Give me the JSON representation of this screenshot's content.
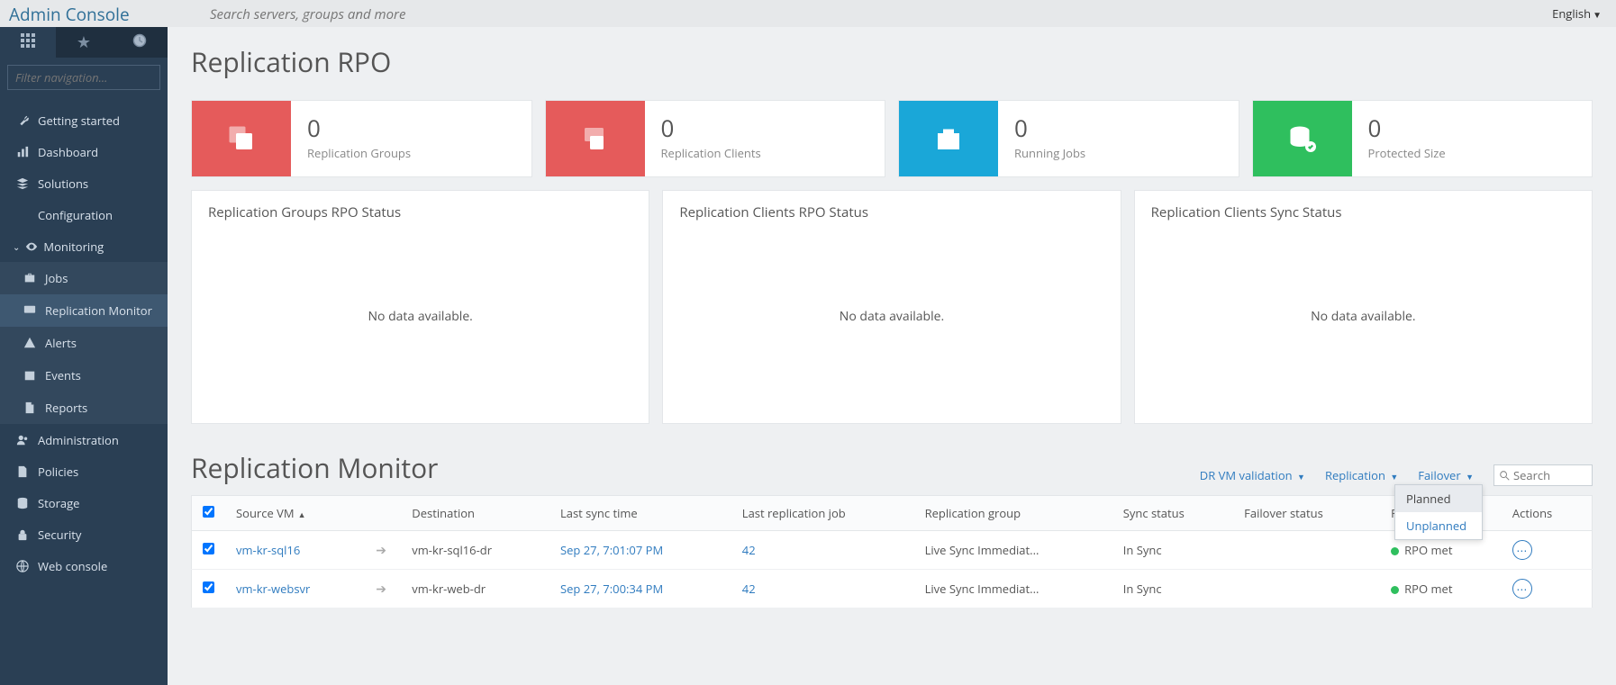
{
  "app_title": "Admin Console",
  "global_search_placeholder": "Search servers, groups and more",
  "language": "English",
  "nav_filter_placeholder": "Filter navigation...",
  "nav": {
    "getting_started": "Getting started",
    "dashboard": "Dashboard",
    "solutions": "Solutions",
    "configuration": "Configuration",
    "monitoring": "Monitoring",
    "jobs": "Jobs",
    "replication_monitor": "Replication Monitor",
    "alerts": "Alerts",
    "events": "Events",
    "reports": "Reports",
    "administration": "Administration",
    "policies": "Policies",
    "storage": "Storage",
    "security": "Security",
    "web_console": "Web console"
  },
  "page_title": "Replication RPO",
  "kpis": [
    {
      "value": "0",
      "label": "Replication Groups",
      "color": "red"
    },
    {
      "value": "0",
      "label": "Replication Clients",
      "color": "red"
    },
    {
      "value": "0",
      "label": "Running Jobs",
      "color": "blue"
    },
    {
      "value": "0",
      "label": "Protected Size",
      "color": "green"
    }
  ],
  "panels": [
    {
      "title": "Replication Groups RPO Status",
      "body": "No data available."
    },
    {
      "title": "Replication Clients RPO Status",
      "body": "No data available."
    },
    {
      "title": "Replication Clients Sync Status",
      "body": "No data available."
    }
  ],
  "monitor_title": "Replication Monitor",
  "monitor_actions": {
    "drvm": "DR VM validation",
    "replication": "Replication",
    "failover": "Failover",
    "search_placeholder": "Search"
  },
  "failover_menu": {
    "planned": "Planned",
    "unplanned": "Unplanned"
  },
  "grid": {
    "cols": {
      "source": "Source VM",
      "destination": "Destination",
      "last_sync": "Last sync time",
      "last_job": "Last replication job",
      "group": "Replication group",
      "sync": "Sync status",
      "failover": "Failover status",
      "rpo": "RPO status",
      "actions": "Actions"
    },
    "rows": [
      {
        "source": "vm-kr-sql16",
        "destination": "vm-kr-sql16-dr",
        "last_sync": "Sep 27, 7:01:07 PM",
        "last_job": "42",
        "group": "Live Sync Immediat...",
        "sync": "In Sync",
        "failover": "",
        "rpo": "RPO met"
      },
      {
        "source": "vm-kr-websvr",
        "destination": "vm-kr-web-dr",
        "last_sync": "Sep 27, 7:00:34 PM",
        "last_job": "42",
        "group": "Live Sync Immediat...",
        "sync": "In Sync",
        "failover": "",
        "rpo": "RPO met"
      }
    ]
  }
}
